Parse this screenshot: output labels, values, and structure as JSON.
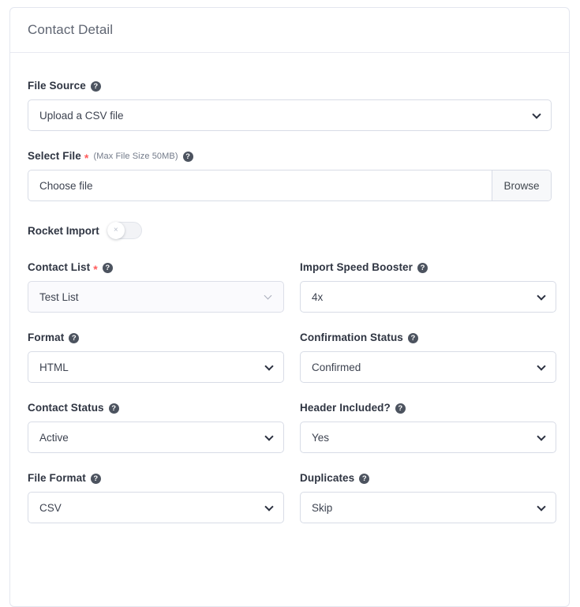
{
  "card": {
    "title": "Contact Detail"
  },
  "fields": {
    "file_source": {
      "label": "File Source",
      "help_icon": "question-circle-icon",
      "value": "Upload a CSV file"
    },
    "select_file": {
      "label": "Select File",
      "required_marker": "*",
      "note": "(Max File Size 50MB)",
      "help_icon": "question-circle-icon",
      "placeholder": "Choose file",
      "browse_label": "Browse"
    },
    "rocket_import": {
      "label": "Rocket Import",
      "state": "off",
      "knob_glyph": "×"
    },
    "contact_list": {
      "label": "Contact List",
      "required_marker": "*",
      "help_icon": "question-circle-icon",
      "value": "Test List"
    },
    "import_speed_booster": {
      "label": "Import Speed Booster",
      "help_icon": "question-circle-icon",
      "value": "4x"
    },
    "format": {
      "label": "Format",
      "help_icon": "question-circle-icon",
      "value": "HTML"
    },
    "confirmation_status": {
      "label": "Confirmation Status",
      "help_icon": "question-circle-icon",
      "value": "Confirmed"
    },
    "contact_status": {
      "label": "Contact Status",
      "help_icon": "question-circle-icon",
      "value": "Active"
    },
    "header_included": {
      "label": "Header Included?",
      "help_icon": "question-circle-icon",
      "value": "Yes"
    },
    "file_format": {
      "label": "File Format",
      "help_icon": "question-circle-icon",
      "value": "CSV"
    },
    "duplicates": {
      "label": "Duplicates",
      "help_icon": "question-circle-icon",
      "value": "Skip"
    }
  },
  "icons": {
    "help": "?"
  },
  "colors": {
    "required": "#ff5c5c",
    "border": "#d8dce6",
    "title": "#5f6572",
    "label": "#2f3542"
  }
}
